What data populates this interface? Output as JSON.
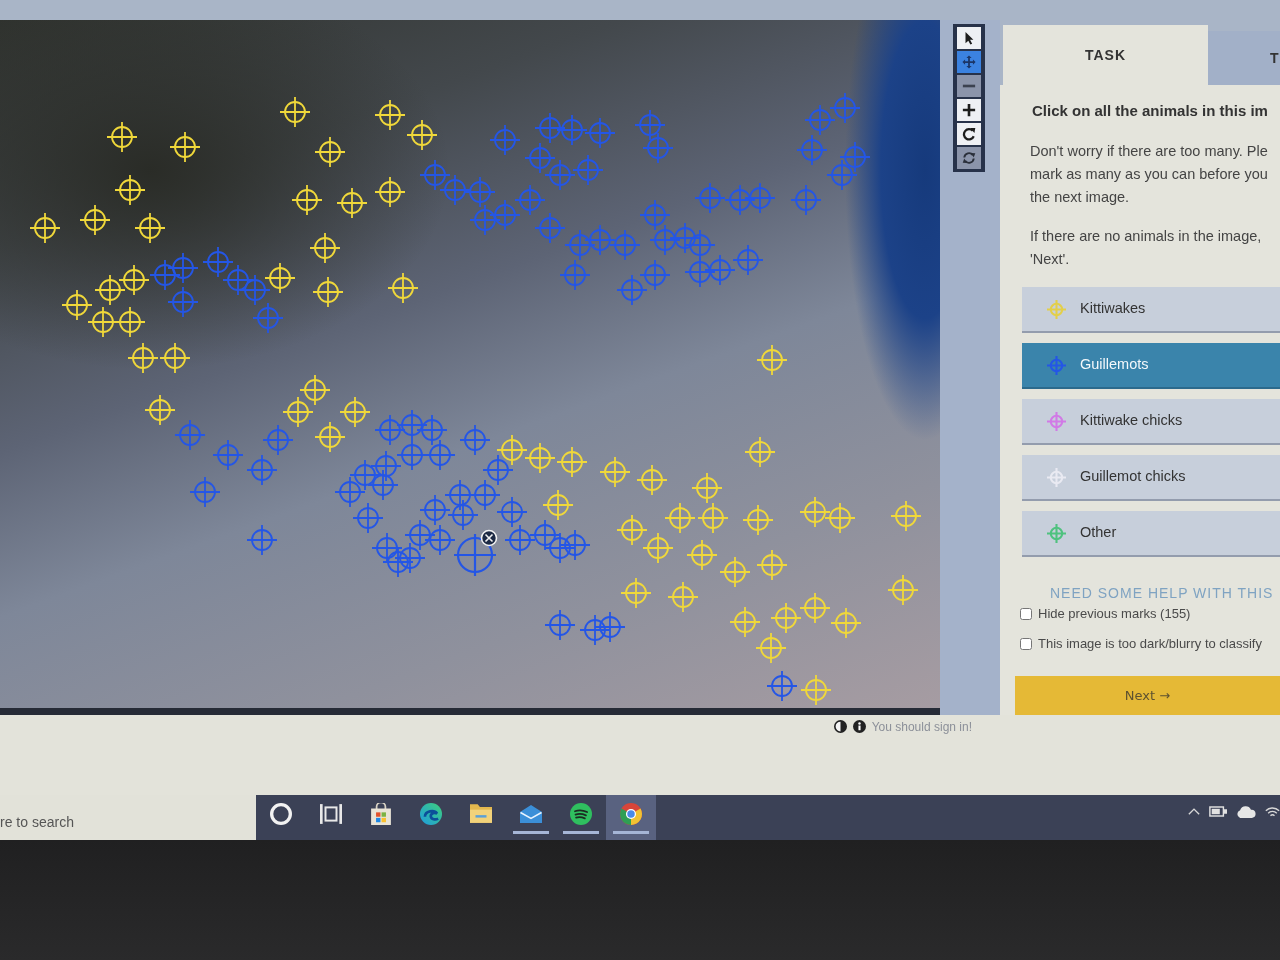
{
  "image": {
    "marks": [
      {
        "color": "#f0d83a",
        "selected": false
      },
      {
        "color": "#f0d83a",
        "selected": false
      },
      {
        "color": "#f0d83a",
        "selected": false
      },
      {
        "color": "#f0d83a",
        "selected": false
      },
      {
        "color": "#f0d83a",
        "selected": false
      },
      {
        "color": "#f0d83a",
        "selected": false
      },
      {
        "color": "#f0d83a",
        "selected": false
      },
      {
        "color": "#f0d83a",
        "selected": false
      },
      {
        "color": "#f0d83a",
        "selected": false
      },
      {
        "color": "#f0d83a",
        "selected": false
      },
      {
        "color": "#f0d83a",
        "selected": false
      },
      {
        "color": "#f0d83a",
        "selected": false
      },
      {
        "color": "#f0d83a",
        "selected": false
      },
      {
        "color": "#f0d83a",
        "selected": false
      },
      {
        "color": "#f0d83a",
        "selected": false
      },
      {
        "color": "#f0d83a",
        "selected": false
      },
      {
        "color": "#f0d83a",
        "selected": false
      },
      {
        "color": "#f0d83a",
        "selected": false
      },
      {
        "color": "#f0d83a",
        "selected": false
      },
      {
        "color": "#f0d83a",
        "selected": false
      },
      {
        "color": "#f0d83a",
        "selected": false
      },
      {
        "color": "#f0d83a",
        "selected": false
      },
      {
        "color": "#f0d83a",
        "selected": false
      },
      {
        "color": "#f0d83a",
        "selected": false
      },
      {
        "color": "#f0d83a",
        "selected": false
      },
      {
        "color": "#f0d83a",
        "selected": false
      },
      {
        "color": "#f0d83a",
        "selected": false
      },
      {
        "color": "#f0d83a",
        "selected": false
      },
      {
        "color": "#f0d83a",
        "selected": false
      },
      {
        "color": "#f0d83a",
        "selected": false
      },
      {
        "color": "#f0d83a",
        "selected": false
      },
      {
        "color": "#f0d83a",
        "selected": false
      },
      {
        "color": "#f0d83a",
        "selected": false
      },
      {
        "color": "#f0d83a",
        "selected": false
      },
      {
        "color": "#f0d83a",
        "selected": false
      },
      {
        "color": "#f0d83a",
        "selected": false
      },
      {
        "color": "#f0d83a",
        "selected": false
      },
      {
        "color": "#f0d83a",
        "selected": false
      },
      {
        "color": "#f0d83a",
        "selected": false
      },
      {
        "color": "#f0d83a",
        "selected": false
      },
      {
        "color": "#f0d83a",
        "selected": false
      },
      {
        "color": "#f0d83a",
        "selected": false
      },
      {
        "color": "#f0d83a",
        "selected": false
      },
      {
        "color": "#f0d83a",
        "selected": false
      },
      {
        "color": "#f0d83a",
        "selected": false
      },
      {
        "color": "#f0d83a",
        "selected": false
      },
      {
        "color": "#f0d83a",
        "selected": false
      },
      {
        "color": "#f0d83a",
        "selected": false
      },
      {
        "color": "#f0d83a",
        "selected": false
      },
      {
        "color": "#f0d83a",
        "selected": false
      },
      {
        "color": "#f0d83a",
        "selected": false
      },
      {
        "color": "#f0d83a",
        "selected": false
      },
      {
        "color": "#f0d83a",
        "selected": false
      },
      {
        "color": "#f0d83a",
        "selected": false
      },
      {
        "color": "#f0d83a",
        "selected": false
      },
      {
        "color": "#f0d83a",
        "selected": false
      },
      {
        "color": "#f0d83a",
        "selected": false
      },
      {
        "color": "#f0d83a",
        "selected": false
      },
      {
        "color": "#2456e6",
        "selected": false
      },
      {
        "color": "#2456e6",
        "selected": false
      },
      {
        "color": "#2456e6",
        "selected": false
      },
      {
        "color": "#2456e6",
        "selected": false
      },
      {
        "color": "#2456e6",
        "selected": false
      },
      {
        "color": "#2456e6",
        "selected": false
      },
      {
        "color": "#2456e6",
        "selected": false
      },
      {
        "color": "#2456e6",
        "selected": false
      },
      {
        "color": "#2456e6",
        "selected": false
      },
      {
        "color": "#2456e6",
        "selected": false
      },
      {
        "color": "#2456e6",
        "selected": false
      },
      {
        "color": "#2456e6",
        "selected": false
      },
      {
        "color": "#2456e6",
        "selected": false
      },
      {
        "color": "#2456e6",
        "selected": false
      },
      {
        "color": "#2456e6",
        "selected": false
      },
      {
        "color": "#2456e6",
        "selected": false
      },
      {
        "color": "#2456e6",
        "selected": false
      },
      {
        "color": "#2456e6",
        "selected": false
      },
      {
        "color": "#2456e6",
        "selected": false
      },
      {
        "color": "#2456e6",
        "selected": false
      },
      {
        "color": "#2456e6",
        "selected": false
      },
      {
        "color": "#2456e6",
        "selected": false
      },
      {
        "color": "#2456e6",
        "selected": false
      },
      {
        "color": "#2456e6",
        "selected": false
      },
      {
        "color": "#2456e6",
        "selected": false
      },
      {
        "color": "#2456e6",
        "selected": false
      },
      {
        "color": "#2456e6",
        "selected": false
      },
      {
        "color": "#2456e6",
        "selected": false
      },
      {
        "color": "#2456e6",
        "selected": false
      },
      {
        "color": "#2456e6",
        "selected": false
      },
      {
        "color": "#2456e6",
        "selected": false
      },
      {
        "color": "#2456e6",
        "selected": false
      },
      {
        "color": "#2456e6",
        "selected": false
      },
      {
        "color": "#2456e6",
        "selected": false
      },
      {
        "color": "#2456e6",
        "selected": false
      },
      {
        "color": "#2456e6",
        "selected": false
      },
      {
        "color": "#2456e6",
        "selected": false
      },
      {
        "color": "#2456e6",
        "selected": false
      },
      {
        "color": "#2456e6",
        "selected": false
      },
      {
        "color": "#2456e6",
        "selected": false
      },
      {
        "color": "#2456e6",
        "selected": false
      },
      {
        "color": "#2456e6",
        "selected": false
      },
      {
        "color": "#2456e6",
        "selected": false
      },
      {
        "color": "#2456e6",
        "selected": false
      },
      {
        "color": "#2456e6",
        "selected": false
      },
      {
        "color": "#2456e6",
        "selected": false
      },
      {
        "color": "#2456e6",
        "selected": false
      },
      {
        "color": "#2456e6",
        "selected": false
      },
      {
        "color": "#2456e6",
        "selected": false
      },
      {
        "color": "#2456e6",
        "selected": false
      },
      {
        "color": "#2456e6",
        "selected": false
      },
      {
        "color": "#2456e6",
        "selected": false
      },
      {
        "color": "#2456e6",
        "selected": false
      },
      {
        "color": "#2456e6",
        "selected": false
      },
      {
        "color": "#2456e6",
        "selected": false
      },
      {
        "color": "#2456e6",
        "selected": false
      },
      {
        "color": "#2456e6",
        "selected": false
      },
      {
        "color": "#2456e6",
        "selected": false
      },
      {
        "color": "#2456e6",
        "selected": false
      },
      {
        "color": "#2456e6",
        "selected": false
      },
      {
        "color": "#2456e6",
        "selected": false
      },
      {
        "color": "#2456e6",
        "selected": false
      },
      {
        "color": "#2456e6",
        "selected": false
      },
      {
        "color": "#2456e6",
        "selected": false
      },
      {
        "color": "#2456e6",
        "selected": false
      },
      {
        "color": "#2456e6",
        "selected": false
      },
      {
        "color": "#2456e6",
        "selected": false
      },
      {
        "color": "#2456e6",
        "selected": false
      },
      {
        "color": "#2456e6",
        "selected": false
      },
      {
        "color": "#2456e6",
        "selected": false
      },
      {
        "color": "#2456e6",
        "selected": false
      },
      {
        "color": "#2456e6",
        "selected": false
      },
      {
        "color": "#2456e6",
        "selected": false
      },
      {
        "color": "#2456e6",
        "selected": false
      },
      {
        "color": "#2456e6",
        "selected": false
      },
      {
        "color": "#2456e6",
        "selected": false
      },
      {
        "color": "#2456e6",
        "selected": false
      },
      {
        "color": "#2456e6",
        "selected": false
      },
      {
        "color": "#2456e6",
        "selected": false
      },
      {
        "color": "#2456e6",
        "selected": false
      },
      {
        "color": "#2456e6",
        "selected": false
      },
      {
        "color": "#2456e6",
        "selected": true
      }
    ]
  },
  "toolbar": [
    {
      "kind": "pointer",
      "selected": false,
      "disabled": false
    },
    {
      "kind": "move",
      "selected": true,
      "disabled": false
    },
    {
      "kind": "zoom-out",
      "selected": false,
      "disabled": true
    },
    {
      "kind": "zoom-in",
      "selected": false,
      "disabled": false
    },
    {
      "kind": "rotate",
      "selected": false,
      "disabled": false
    },
    {
      "kind": "reset",
      "selected": false,
      "disabled": true
    }
  ],
  "tabs": [
    {
      "label": "TASK",
      "selected": true
    },
    {
      "label": "T",
      "selected": false
    }
  ],
  "task": {
    "question": "Click on all the animals in this im",
    "paragraphs": [
      {
        "lines": [
          "Don't worry if there are too many. Ple",
          "mark as many as you can before you",
          "the next image."
        ]
      },
      {
        "lines": [
          "If there are no animals in the image,",
          "'Next'."
        ]
      }
    ],
    "tools": [
      {
        "label": "Kittiwakes",
        "color": "#e3cf4a",
        "selected": false
      },
      {
        "label": "Guillemots",
        "color": "#2456e6",
        "selected": true
      },
      {
        "label": "Kittiwake chicks",
        "color": "#d17ae6",
        "selected": false
      },
      {
        "label": "Guillemot chicks",
        "color": "#e9eaf2",
        "selected": false
      },
      {
        "label": "Other",
        "color": "#4fc27f",
        "selected": false
      }
    ]
  },
  "help": "NEED SOME HELP WITH THIS",
  "options": [
    {
      "label": "Hide previous marks (155)",
      "checked": false
    },
    {
      "label": "This image is too dark/blurry to classify",
      "checked": false
    }
  ],
  "next_button": "Next →",
  "footer": {
    "message": "You should sign in!"
  },
  "taskbar": {
    "search": {
      "placeholder": "re to search"
    },
    "apps": [
      {
        "kind": "circle",
        "running": false,
        "selected": false
      },
      {
        "kind": "taskview",
        "running": false,
        "selected": false
      },
      {
        "kind": "store",
        "running": false,
        "selected": false
      },
      {
        "kind": "swirl",
        "running": false,
        "selected": false
      },
      {
        "kind": "folder",
        "running": false,
        "selected": false
      },
      {
        "kind": "mail",
        "running": true,
        "selected": false
      },
      {
        "kind": "music",
        "running": true,
        "selected": false
      },
      {
        "kind": "browser",
        "running": true,
        "selected": true
      }
    ],
    "tray": [
      {
        "kind": "chevron"
      },
      {
        "kind": "device"
      },
      {
        "kind": "cloud"
      },
      {
        "kind": "wifi"
      }
    ]
  }
}
